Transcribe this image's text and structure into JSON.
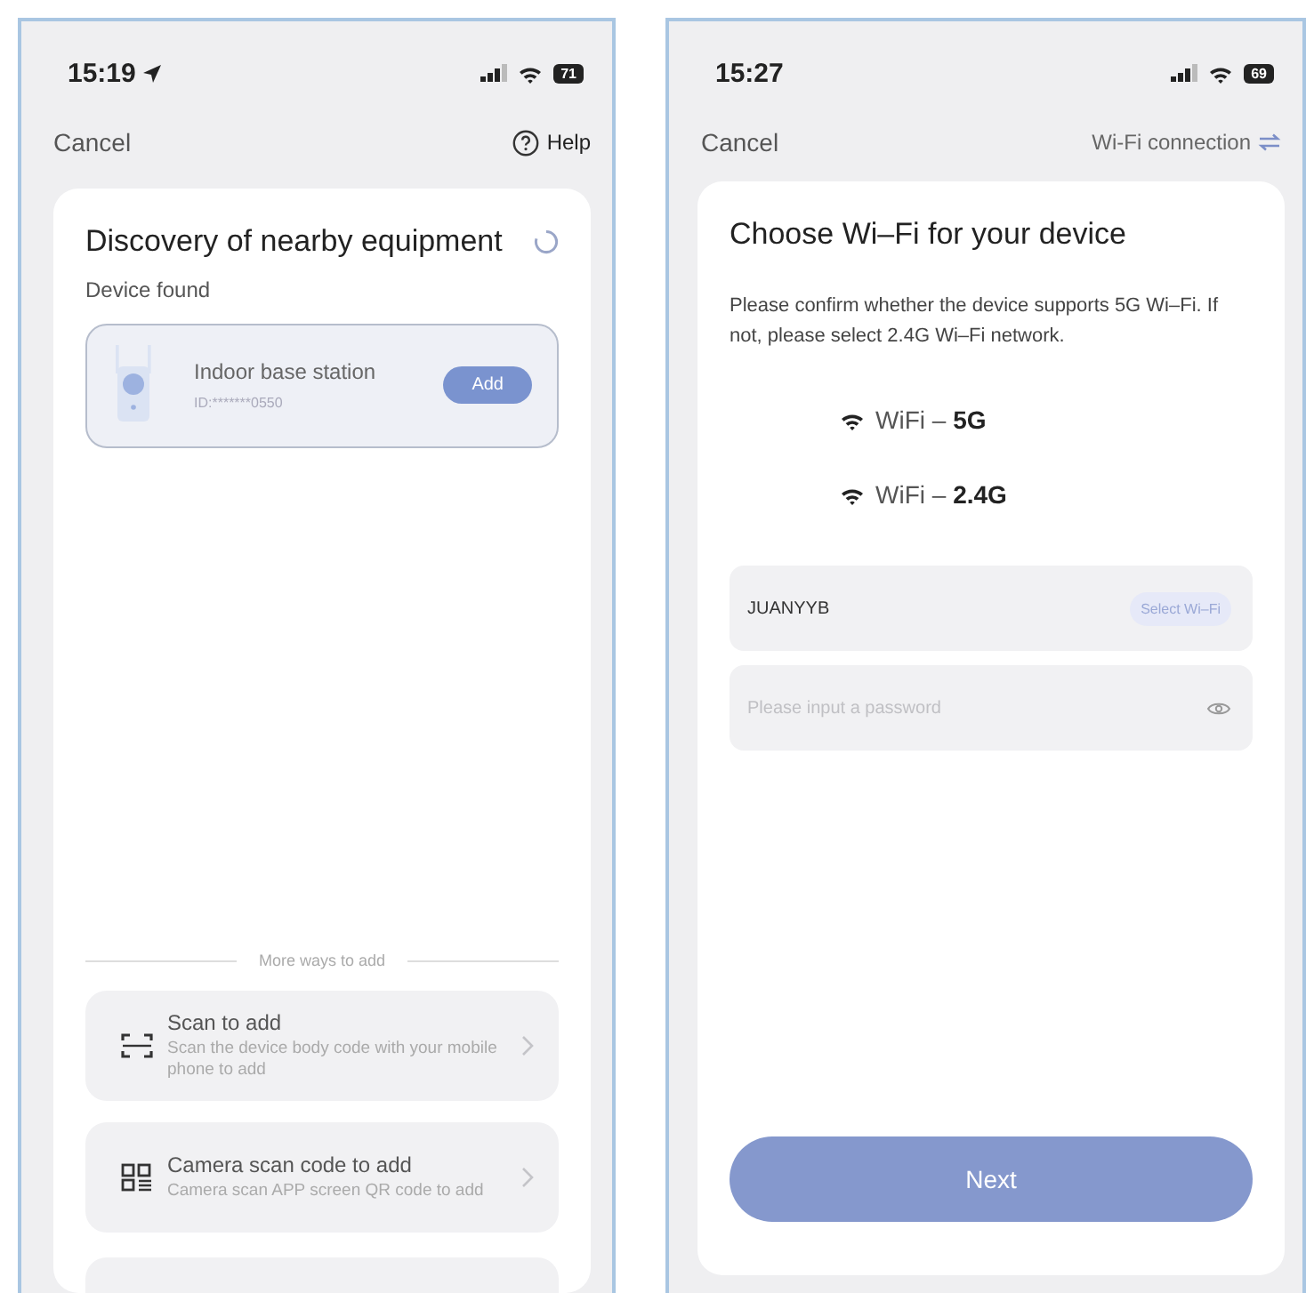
{
  "screens": [
    {
      "status_bar": {
        "time": "15:19",
        "location": true,
        "battery": "71"
      },
      "nav": {
        "cancel": "Cancel",
        "action": "Help",
        "kind": "help"
      },
      "card": {
        "kind": "discovery",
        "title": "Discovery of nearby equipment",
        "subtitle": "Device found",
        "device": {
          "name": "Indoor base station",
          "id": "ID:*******0550",
          "button": "Add"
        },
        "divider_label": "More ways to add",
        "options": [
          {
            "kind": "scan",
            "title": "Scan to add",
            "description": "Scan the device body code with your mobile phone to add"
          },
          {
            "kind": "qr",
            "title": "Camera scan code to add",
            "description": "Camera scan APP screen QR code to add"
          },
          {
            "kind": "cut"
          }
        ]
      }
    },
    {
      "status_bar": {
        "time": "15:27",
        "location": false,
        "battery": "69"
      },
      "nav": {
        "cancel": "Cancel",
        "action": "Wi-Fi connection",
        "kind": "swap"
      },
      "card": {
        "kind": "wifi",
        "title": "Choose Wi–Fi for your device",
        "description": "Please confirm whether the device supports 5G Wi–Fi. If not, please select 2.4G Wi–Fi network.",
        "bands": [
          "WiFi – **5G**",
          "WiFi – **2.4G**"
        ],
        "ssid": {
          "value": "JUANYYB",
          "button": "Select Wi–Fi"
        },
        "password": {
          "placeholder": "Please input a password"
        },
        "next": "Next"
      }
    }
  ]
}
